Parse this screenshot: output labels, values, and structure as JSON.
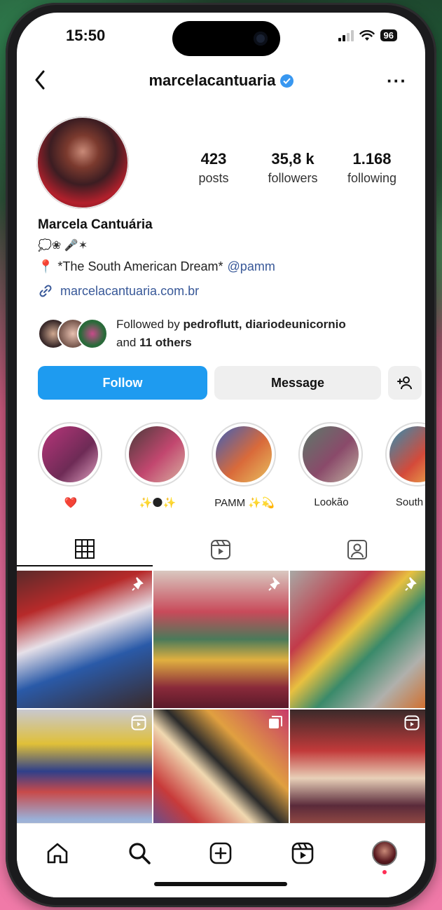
{
  "status_bar": {
    "time": "15:50",
    "battery": "96"
  },
  "header": {
    "username": "marcelacantuaria",
    "more": "···"
  },
  "profile": {
    "stats": [
      {
        "value": "423",
        "label": "posts"
      },
      {
        "value": "35,8 k",
        "label": "followers"
      },
      {
        "value": "1.168",
        "label": "following"
      }
    ],
    "full_name": "Marcela Cantuária",
    "bio_line1": "💭❀ 🎤✶",
    "bio_line2_text": "*The South American Dream*",
    "bio_line2_emoji": "📍",
    "bio_mention": "@pamm",
    "link": "marcelacantuaria.com.br",
    "followed_by_prefix": "Followed by ",
    "followed_by_names": "pedroflutt, diariodeunicornio",
    "followed_by_and": "and ",
    "followed_by_others": "11 others"
  },
  "buttons": {
    "follow": "Follow",
    "message": "Message"
  },
  "highlights": [
    {
      "label": "❤️",
      "color_a": "#b8357a",
      "color_b": "#6e2b56"
    },
    {
      "label": "✨🌑✨",
      "color_a": "#4a3a3a",
      "color_b": "#c2476f"
    },
    {
      "label": "PAMM ✨💫",
      "color_a": "#3d5fb8",
      "color_b": "#d96a3a"
    },
    {
      "label": "Lookão",
      "color_a": "#5c7a6a",
      "color_b": "#8a4a6a"
    },
    {
      "label": "South am",
      "color_a": "#2f8fb3",
      "color_b": "#d44a3a"
    }
  ],
  "tabs": [
    {
      "name": "grid",
      "icon": "grid-icon"
    },
    {
      "name": "reels",
      "icon": "reels-icon"
    },
    {
      "name": "tagged",
      "icon": "tagged-icon"
    }
  ],
  "posts": [
    {
      "icon": "pin-icon",
      "colors": [
        "#b72a2a",
        "#e6e0e8",
        "#2a5aa8"
      ]
    },
    {
      "icon": "pin-icon",
      "colors": [
        "#d9c8c0",
        "#8a2a3a",
        "#4a7a5a"
      ]
    },
    {
      "icon": "pin-icon",
      "colors": [
        "#a8a8a4",
        "#c23a4a",
        "#3a8a6a"
      ]
    },
    {
      "icon": "reels-icon",
      "colors": [
        "#2f3f8a",
        "#e0c038",
        "#c8c8d0"
      ]
    },
    {
      "icon": "carousel-icon",
      "colors": [
        "#c83a3a",
        "#f0d8b0",
        "#3a5ab8"
      ]
    },
    {
      "icon": "reels-icon",
      "colors": [
        "#3a2a2a",
        "#c23a3a",
        "#e8d0b8"
      ]
    }
  ]
}
